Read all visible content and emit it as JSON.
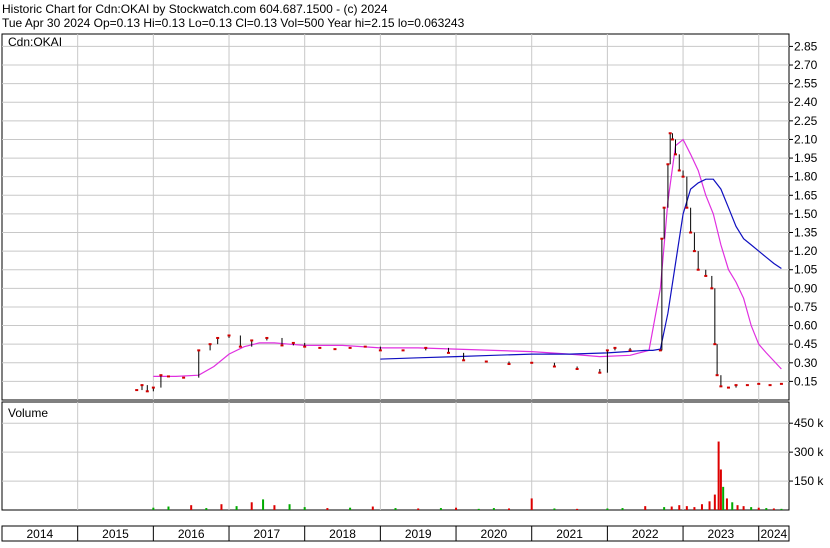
{
  "header": {
    "line1": "Historic Chart for Cdn:OKAI by Stockwatch.com 604.687.1500 - (c) 2024",
    "line2": "Tue Apr 30 2024  Op=0.13  Hi=0.13  Lo=0.13  Cl=0.13  Vol=500  Year hi=2.15  lo=0.063243"
  },
  "colors": {
    "price": "#d00000",
    "ma_short": "#e030e0",
    "ma_long": "#1010c0",
    "vol_up": "#00aa00",
    "vol_down": "#dd0000",
    "grid": "#c8c8c8",
    "border": "#000000"
  },
  "chart_data": [
    {
      "type": "line",
      "label": "Cdn:OKAI",
      "ylim": [
        0.0,
        2.95
      ],
      "yticks": [
        "2.85",
        "2.70",
        "2.55",
        "2.40",
        "2.25",
        "2.10",
        "1.95",
        "1.80",
        "1.65",
        "1.50",
        "1.35",
        "1.20",
        "1.05",
        "0.90",
        "0.75",
        "0.60",
        "0.45",
        "0.30",
        "0.15"
      ],
      "xlim": [
        2014.0,
        2024.4
      ],
      "series": [
        {
          "key": "price",
          "x": [
            2015.78,
            2015.85,
            2015.92,
            2016.0,
            2016.1,
            2016.2,
            2016.4,
            2016.6,
            2016.75,
            2016.85,
            2017.0,
            2017.15,
            2017.3,
            2017.5,
            2017.7,
            2017.85,
            2018.0,
            2018.2,
            2018.4,
            2018.6,
            2018.8,
            2019.0,
            2019.3,
            2019.6,
            2019.9,
            2020.1,
            2020.4,
            2020.7,
            2021.0,
            2021.3,
            2021.6,
            2021.9,
            2022.0,
            2022.1,
            2022.3,
            2022.7,
            2022.72,
            2022.75,
            2022.8,
            2022.83,
            2022.86,
            2022.9,
            2022.95,
            2023.0,
            2023.05,
            2023.1,
            2023.15,
            2023.2,
            2023.3,
            2023.38,
            2023.42,
            2023.45,
            2023.5,
            2023.6,
            2023.7,
            2023.85,
            2024.0,
            2024.15,
            2024.3
          ],
          "y": [
            0.08,
            0.12,
            0.07,
            0.1,
            0.2,
            0.19,
            0.18,
            0.4,
            0.45,
            0.5,
            0.52,
            0.43,
            0.48,
            0.5,
            0.44,
            0.46,
            0.43,
            0.42,
            0.41,
            0.42,
            0.43,
            0.4,
            0.4,
            0.42,
            0.38,
            0.32,
            0.31,
            0.29,
            0.3,
            0.27,
            0.25,
            0.22,
            0.4,
            0.42,
            0.4,
            0.4,
            1.3,
            1.55,
            1.9,
            2.15,
            2.1,
            1.98,
            1.85,
            1.8,
            1.55,
            1.35,
            1.2,
            1.05,
            1.0,
            0.9,
            0.45,
            0.2,
            0.11,
            0.1,
            0.12,
            0.12,
            0.13,
            0.12,
            0.13
          ]
        },
        {
          "key": "ma_short",
          "x": [
            2016.0,
            2016.3,
            2016.6,
            2016.8,
            2017.0,
            2017.2,
            2017.4,
            2017.6,
            2017.8,
            2018.0,
            2018.5,
            2019.0,
            2019.5,
            2020.0,
            2020.5,
            2021.0,
            2021.5,
            2021.9,
            2022.3,
            2022.55,
            2022.7,
            2022.8,
            2022.9,
            2023.0,
            2023.1,
            2023.2,
            2023.3,
            2023.4,
            2023.5,
            2023.6,
            2023.7,
            2023.8,
            2023.9,
            2024.0,
            2024.1,
            2024.3
          ],
          "y": [
            0.19,
            0.19,
            0.2,
            0.27,
            0.37,
            0.43,
            0.46,
            0.46,
            0.45,
            0.44,
            0.44,
            0.42,
            0.42,
            0.41,
            0.4,
            0.39,
            0.37,
            0.35,
            0.36,
            0.4,
            0.9,
            1.6,
            2.05,
            2.1,
            1.98,
            1.85,
            1.65,
            1.5,
            1.25,
            1.05,
            0.95,
            0.82,
            0.6,
            0.45,
            0.38,
            0.25
          ]
        },
        {
          "key": "ma_long",
          "x": [
            2019.0,
            2019.5,
            2020.0,
            2020.5,
            2021.0,
            2021.5,
            2022.0,
            2022.5,
            2022.6,
            2022.7,
            2022.8,
            2022.9,
            2023.0,
            2023.1,
            2023.2,
            2023.3,
            2023.4,
            2023.5,
            2023.6,
            2023.7,
            2023.8,
            2023.9,
            2024.0,
            2024.1,
            2024.2,
            2024.3
          ],
          "y": [
            0.33,
            0.34,
            0.35,
            0.36,
            0.37,
            0.37,
            0.38,
            0.4,
            0.4,
            0.41,
            0.7,
            1.1,
            1.5,
            1.7,
            1.75,
            1.78,
            1.78,
            1.7,
            1.55,
            1.4,
            1.3,
            1.25,
            1.2,
            1.15,
            1.1,
            1.06
          ]
        }
      ]
    },
    {
      "type": "bar",
      "label": "Volume",
      "ylim": [
        0,
        560
      ],
      "yunit": "k",
      "yticks": [
        "450 k",
        "300 k",
        "150 k"
      ],
      "x": [
        2016.0,
        2016.2,
        2016.5,
        2016.7,
        2016.9,
        2017.1,
        2017.3,
        2017.45,
        2017.6,
        2017.8,
        2018.0,
        2018.3,
        2018.6,
        2018.9,
        2019.2,
        2019.5,
        2019.8,
        2020.0,
        2020.3,
        2020.5,
        2020.7,
        2021.0,
        2021.3,
        2021.6,
        2022.0,
        2022.2,
        2022.5,
        2022.75,
        2022.85,
        2022.95,
        2023.05,
        2023.15,
        2023.25,
        2023.35,
        2023.42,
        2023.47,
        2023.5,
        2023.53,
        2023.58,
        2023.65,
        2023.72,
        2023.8,
        2023.9,
        2024.0,
        2024.1,
        2024.2,
        2024.3
      ],
      "values": [
        12,
        18,
        25,
        10,
        30,
        20,
        40,
        55,
        25,
        30,
        15,
        10,
        12,
        18,
        10,
        8,
        10,
        12,
        6,
        10,
        8,
        60,
        8,
        6,
        8,
        10,
        20,
        15,
        18,
        25,
        20,
        15,
        30,
        45,
        80,
        355,
        210,
        120,
        60,
        40,
        25,
        20,
        15,
        12,
        10,
        8,
        6
      ],
      "up": [
        1,
        1,
        0,
        1,
        0,
        1,
        0,
        1,
        0,
        1,
        1,
        0,
        1,
        0,
        1,
        0,
        1,
        0,
        1,
        1,
        0,
        0,
        1,
        0,
        1,
        1,
        0,
        1,
        0,
        0,
        0,
        0,
        0,
        0,
        0,
        0,
        0,
        1,
        0,
        1,
        0,
        0,
        1,
        0,
        1,
        0,
        1
      ]
    }
  ],
  "labels": {
    "price_title": "Cdn:OKAI",
    "volume_title": "Volume"
  },
  "xaxis": {
    "years": [
      "2014",
      "2015",
      "2016",
      "2017",
      "2018",
      "2019",
      "2020",
      "2021",
      "2022",
      "2023",
      "2024"
    ]
  }
}
